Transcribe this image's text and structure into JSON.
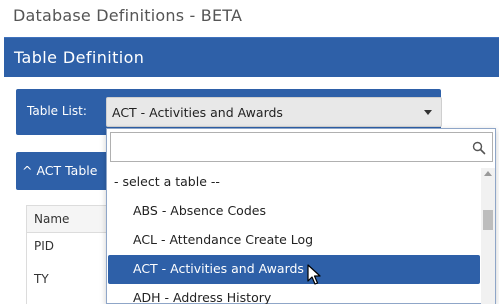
{
  "page": {
    "title": "Database Definitions - BETA"
  },
  "section": {
    "title": "Table Definition"
  },
  "table_list": {
    "label": "Table List:",
    "selected_value": "ACT - Activities and Awards"
  },
  "act_panel": {
    "header": "^ ACT Table"
  },
  "grid": {
    "column_header": "Name",
    "rows": [
      "PID",
      "TY"
    ]
  },
  "dropdown": {
    "search_placeholder": "",
    "options": [
      "- select a table --",
      "ABS - Absence Codes",
      "ACL - Attendance Create Log",
      "ACT - Activities and Awards",
      "ADH - Address History"
    ],
    "highlighted_index": 3
  },
  "colors": {
    "accent": "#2e60a8"
  }
}
